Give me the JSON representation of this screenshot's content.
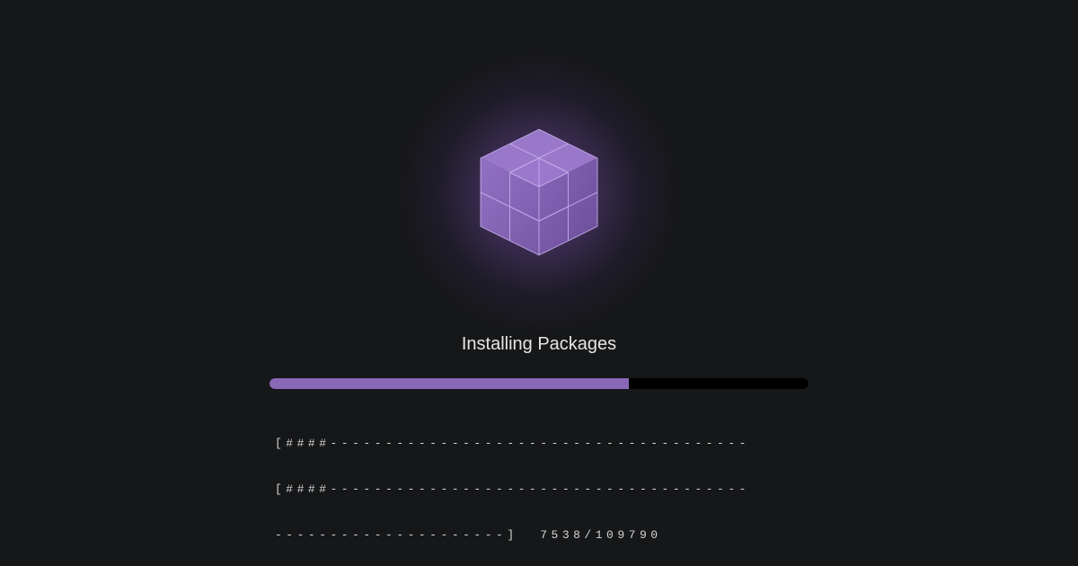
{
  "installer": {
    "title": "Installing Packages",
    "progress": {
      "fraction": 0.6667,
      "fill_color": "#8a68b8",
      "track_color": "#000000"
    },
    "log_lines": [
      "[####--------------------------------------",
      "[####--------------------------------------",
      "---------------------]  7538/109790"
    ],
    "icon": "package-cube-icon"
  }
}
